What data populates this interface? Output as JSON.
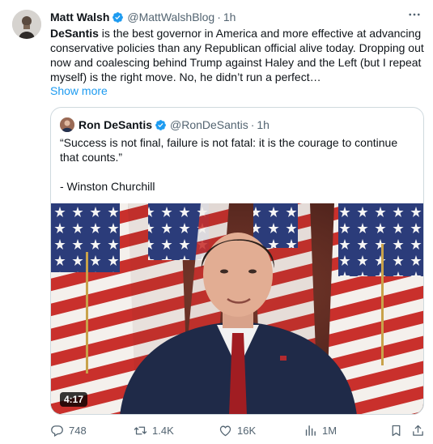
{
  "post": {
    "author_name": "Matt Walsh",
    "author_handle": "@MattWalshBlog",
    "time": "1h",
    "text_bold": "DeSantis",
    "text_rest": " is the best governor in America and more effective at advancing conservative policies than any Republican official alive today. Dropping out now and coalescing behind Trump against Haley and the Left (but I repeat myself) is the right move. No, he didn’t run a perfect…",
    "show_more": "Show more"
  },
  "quote": {
    "author_name": "Ron DeSantis",
    "author_handle": "@RonDeSantis",
    "time": "1h",
    "line1": "“Success is not final, failure is not fatal: it is the courage to continue that counts.”",
    "line2": "- Winston Churchill",
    "video_duration": "4:17"
  },
  "actions": {
    "replies": "748",
    "reposts": "1.4K",
    "likes": "16K",
    "views": "1M"
  },
  "colors": {
    "accent": "#1d9bf0",
    "secondary_text": "#536471",
    "border": "#cfd9de"
  }
}
